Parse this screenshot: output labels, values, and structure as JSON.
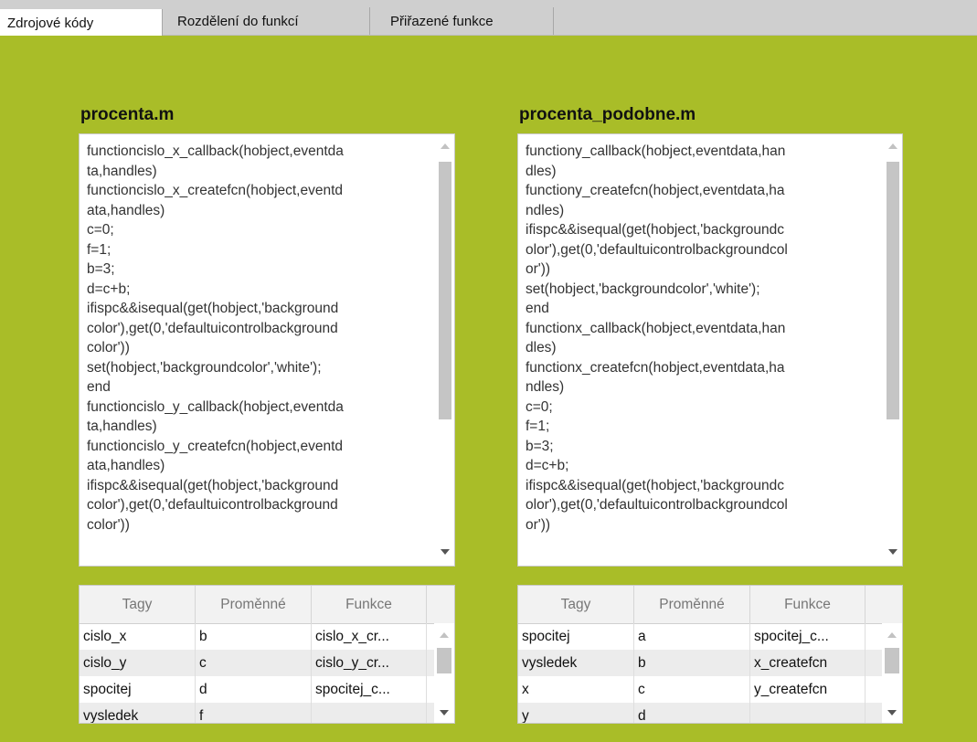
{
  "tabs": [
    {
      "label": "Zdrojové kódy",
      "active": true
    },
    {
      "label": "Rozdělení do funkcí",
      "active": false
    },
    {
      "label": "Přiřazené funkce",
      "active": false
    }
  ],
  "left": {
    "title": "procenta.m",
    "code_lines": [
      "functioncislo_x_callback(hobject,eventda",
      "ta,handles)",
      "functioncislo_x_createfcn(hobject,eventd",
      "ata,handles)",
      "c=0;",
      "f=1;",
      "b=3;",
      "d=c+b;",
      "ifispc&&isequal(get(hobject,'background",
      "color'),get(0,'defaultuicontrolbackground",
      "color'))",
      "set(hobject,'backgroundcolor','white');",
      "end",
      "functioncislo_y_callback(hobject,eventda",
      "ta,handles)",
      "functioncislo_y_createfcn(hobject,eventd",
      "ata,handles)",
      "ifispc&&isequal(get(hobject,'background",
      "color'),get(0,'defaultuicontrolbackground",
      "color'))"
    ],
    "table": {
      "headers": [
        "Tagy",
        "Proměnné",
        "Funkce"
      ],
      "rows": [
        [
          "cislo_x",
          "b",
          "cislo_x_cr..."
        ],
        [
          "cislo_y",
          "c",
          "cislo_y_cr..."
        ],
        [
          "spocitej",
          "d",
          "spocitej_c..."
        ],
        [
          "vysledek",
          "f",
          ""
        ]
      ]
    }
  },
  "right": {
    "title": "procenta_podobne.m",
    "code_lines": [
      "functiony_callback(hobject,eventdata,han",
      "dles)",
      "functiony_createfcn(hobject,eventdata,ha",
      "ndles)",
      "ifispc&&isequal(get(hobject,'backgroundc",
      "olor'),get(0,'defaultuicontrolbackgroundcol",
      "or'))",
      "set(hobject,'backgroundcolor','white');",
      "end",
      "functionx_callback(hobject,eventdata,han",
      "dles)",
      "functionx_createfcn(hobject,eventdata,ha",
      "ndles)",
      "c=0;",
      "f=1;",
      "b=3;",
      "d=c+b;",
      "ifispc&&isequal(get(hobject,'backgroundc",
      "olor'),get(0,'defaultuicontrolbackgroundcol",
      "or'))"
    ],
    "table": {
      "headers": [
        "Tagy",
        "Proměnné",
        "Funkce"
      ],
      "rows": [
        [
          "spocitej",
          "a",
          "spocitej_c..."
        ],
        [
          "vysledek",
          "b",
          "x_createfcn"
        ],
        [
          "x",
          "c",
          "y_createfcn"
        ],
        [
          "y",
          "d",
          ""
        ]
      ]
    }
  },
  "colors": {
    "background": "#a9bd28",
    "tabbar": "#cfcfcf"
  }
}
